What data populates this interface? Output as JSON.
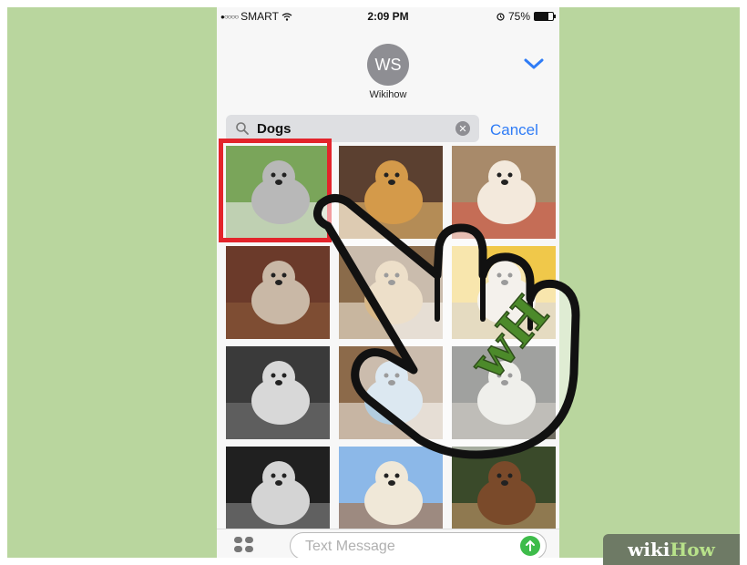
{
  "status_bar": {
    "carrier": "SMART",
    "time": "2:09 PM",
    "battery": "75%"
  },
  "header": {
    "avatar_initials": "WS",
    "contact_name": "Wikihow",
    "chevron_icon": "chevron-down-icon"
  },
  "search": {
    "value": "Dogs",
    "clear_icon": "clear-icon",
    "cancel_label": "Cancel"
  },
  "gif_results": [
    {
      "name": "gif-result-1",
      "palette": [
        "#7aa55a",
        "#b8b8b8",
        "#ececec"
      ]
    },
    {
      "name": "gif-result-2",
      "palette": [
        "#5b4030",
        "#d49a4a",
        "#f0c070"
      ]
    },
    {
      "name": "gif-result-3",
      "palette": [
        "#a88a6a",
        "#f3e9dc",
        "#d95a4a"
      ]
    },
    {
      "name": "gif-result-4",
      "palette": [
        "#6b3a2a",
        "#c9b8a6",
        "#8a5a3a"
      ]
    },
    {
      "name": "gif-result-5",
      "palette": [
        "#8a6b4a",
        "#d8b888",
        "#f2e8d8"
      ]
    },
    {
      "name": "gif-result-6",
      "palette": [
        "#f0c84a",
        "#e6e1d4",
        "#a8a092"
      ]
    },
    {
      "name": "gif-result-7",
      "palette": [
        "#3a3a3a",
        "#d8d8d8",
        "#777777"
      ]
    },
    {
      "name": "gif-result-8",
      "palette": [
        "#8c6a4a",
        "#b2cde0",
        "#efe8e0"
      ]
    },
    {
      "name": "gif-result-9",
      "palette": [
        "#2e2f2a",
        "#dcdcd2",
        "#9e9a8a"
      ]
    },
    {
      "name": "gif-result-10",
      "palette": [
        "#202020",
        "#d4d4d4",
        "#8c8c8c"
      ]
    },
    {
      "name": "gif-result-11",
      "palette": [
        "#8cb8e8",
        "#f0e8d8",
        "#a86a3a"
      ]
    },
    {
      "name": "gif-result-12",
      "palette": [
        "#3a4a2a",
        "#7a4a2a",
        "#c89a6a"
      ]
    }
  ],
  "bottom_bar": {
    "apps_icon": "app-drawer-icon",
    "message_placeholder": "Text Message",
    "send_icon": "send-arrow-icon"
  },
  "watermark": {
    "badge_letters": "wH",
    "brand_wiki": "wiki",
    "brand_how": "How"
  },
  "colors": {
    "background": "#b9d69e",
    "accent": "#2f7cf6",
    "selection": "#e3242b",
    "send": "#3ebc4a",
    "badge_green": "#4c8a2a"
  }
}
